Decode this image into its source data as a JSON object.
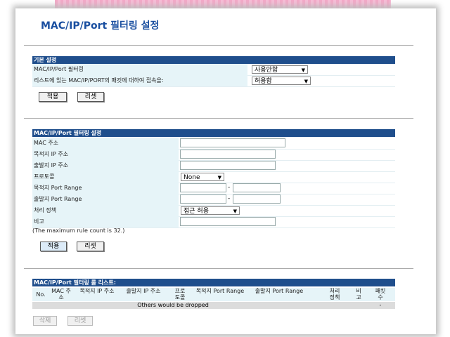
{
  "page": {
    "title": "MAC/IP/Port 필터링 설정"
  },
  "basic": {
    "header": "기본 설정",
    "filter_label": "MAC/IP/Port 필터링",
    "filter_value": "사용안함",
    "default_label": "리스트에 있는 MAC/IP/PORT의 패킷에 대하여 접속을:",
    "default_value": "허용함",
    "apply": "적용",
    "reset": "리셋"
  },
  "rule_form": {
    "header": "MAC/IP/Port 필터링 설정",
    "mac_label": "MAC 주소",
    "dst_ip_label": "목적지 IP 주소",
    "src_ip_label": "출발지 IP 주소",
    "protocol_label": "프로토콜",
    "protocol_value": "None",
    "dst_port_label": "목적지 Port Range",
    "src_port_label": "출발지 Port Range",
    "range_sep": "-",
    "action_label": "처리 정책",
    "action_value": "접근 허용",
    "comment_label": "비고",
    "note": "(The maximum rule count is 32.)",
    "apply": "적용",
    "reset": "리셋"
  },
  "rule_list": {
    "header": "MAC/IP/Port 필터링 룰 리스트:",
    "columns": [
      "No.",
      "MAC 주소",
      "목적지 IP 주소",
      "출발지 IP 주소",
      "프로 토콜",
      "목적지 Port Range",
      "출발지 Port Range",
      "처리 정책",
      "비고",
      "패킷 수"
    ],
    "default_row_text": "Others would be dropped",
    "default_row_count": "-",
    "delete": "삭제",
    "reset": "리셋"
  },
  "colors": {
    "accent": "#1a4fa0",
    "section_header": "#1f4e8c",
    "label_bg": "#e6f4f8"
  }
}
